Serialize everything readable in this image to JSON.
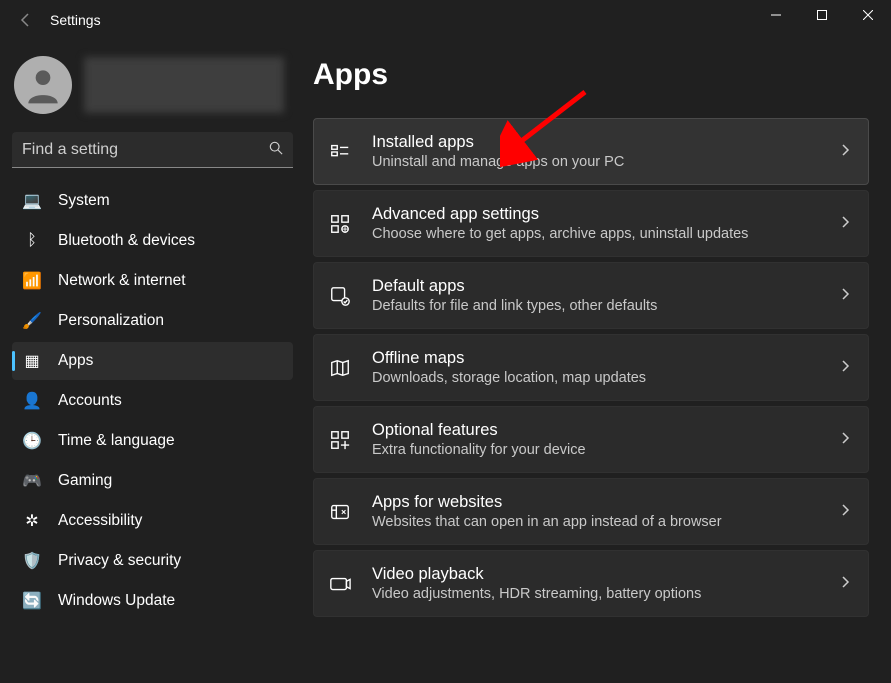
{
  "window": {
    "title": "Settings"
  },
  "search": {
    "placeholder": "Find a setting"
  },
  "nav": {
    "items": [
      {
        "label": "System",
        "icon": "💻"
      },
      {
        "label": "Bluetooth & devices",
        "icon": "ᛒ"
      },
      {
        "label": "Network & internet",
        "icon": "📶"
      },
      {
        "label": "Personalization",
        "icon": "🖌️"
      },
      {
        "label": "Apps",
        "icon": "▦"
      },
      {
        "label": "Accounts",
        "icon": "👤"
      },
      {
        "label": "Time & language",
        "icon": "🕒"
      },
      {
        "label": "Gaming",
        "icon": "🎮"
      },
      {
        "label": "Accessibility",
        "icon": "✲"
      },
      {
        "label": "Privacy & security",
        "icon": "🛡️"
      },
      {
        "label": "Windows Update",
        "icon": "🔄"
      }
    ],
    "selected_index": 4
  },
  "page": {
    "title": "Apps",
    "cards": [
      {
        "title": "Installed apps",
        "desc": "Uninstall and manage apps on your PC",
        "highlighted": true
      },
      {
        "title": "Advanced app settings",
        "desc": "Choose where to get apps, archive apps, uninstall updates"
      },
      {
        "title": "Default apps",
        "desc": "Defaults for file and link types, other defaults"
      },
      {
        "title": "Offline maps",
        "desc": "Downloads, storage location, map updates"
      },
      {
        "title": "Optional features",
        "desc": "Extra functionality for your device"
      },
      {
        "title": "Apps for websites",
        "desc": "Websites that can open in an app instead of a browser"
      },
      {
        "title": "Video playback",
        "desc": "Video adjustments, HDR streaming, battery options"
      }
    ]
  }
}
